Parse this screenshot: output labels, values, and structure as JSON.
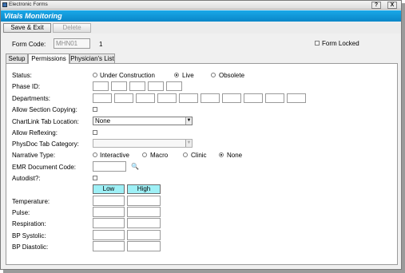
{
  "window": {
    "title": "Electronic Forms",
    "help_glyph": "?",
    "close_glyph": "X"
  },
  "form_bar": {
    "title": "Vitals Monitoring"
  },
  "toolbar": {
    "save_exit": "Save & Exit",
    "delete": "Delete"
  },
  "header": {
    "form_code_label": "Form Code:",
    "form_code_value": "MHN01",
    "form_number": "1",
    "form_locked_label": "Form Locked"
  },
  "tabs": [
    "Setup",
    "Permissions",
    "Physician's List"
  ],
  "fields": {
    "status_label": "Status:",
    "status_options": [
      "Under Construction",
      "Live",
      "Obsolete"
    ],
    "phase_id_label": "Phase ID:",
    "departments_label": "Departments:",
    "allow_section_copying_label": "Allow Section Copying:",
    "chartlink_label": "ChartLink Tab Location:",
    "chartlink_value": "None",
    "allow_reflexing_label": "Allow Reflexing:",
    "physdoc_label": "PhysDoc Tab Category:",
    "physdoc_value": "",
    "narrative_label": "Narrative Type:",
    "narrative_options": [
      "Interactive",
      "Macro",
      "Clinic",
      "None"
    ],
    "emr_label": "EMR Document Code:",
    "autodist_label": "Autodist?:"
  },
  "ranges": {
    "low_header": "Low",
    "high_header": "High",
    "rows": [
      "Temperature:",
      "Pulse:",
      "Respiration:",
      "BP Systolic:",
      "BP Diastolic:"
    ]
  },
  "colors": {
    "form_bar": "#0a86c8",
    "range_header": "#9ef0f6"
  }
}
